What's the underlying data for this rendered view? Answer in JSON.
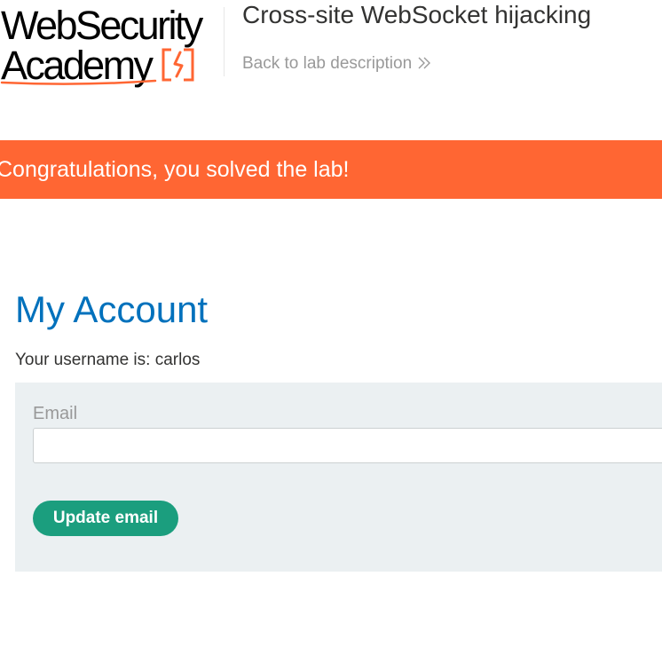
{
  "header": {
    "logo_line1": "WebSecurity",
    "logo_line2": "Academy",
    "lab_title": "Cross-site WebSocket hijacking",
    "back_link": "Back to lab description"
  },
  "banner": {
    "message": "Congratulations, you solved the lab!"
  },
  "account": {
    "title": "My Account",
    "username_text": "Your username is: carlos",
    "email_label": "Email",
    "email_value": "",
    "update_button": "Update email"
  },
  "colors": {
    "accent_orange": "#ff6633",
    "title_blue": "#0071bc",
    "button_green": "#1b9e7e",
    "panel_bg": "#ebf0f2"
  },
  "icons": {
    "logo_mark": "lightning-bracket-icon",
    "back_link": "double-chevron-right-icon"
  }
}
